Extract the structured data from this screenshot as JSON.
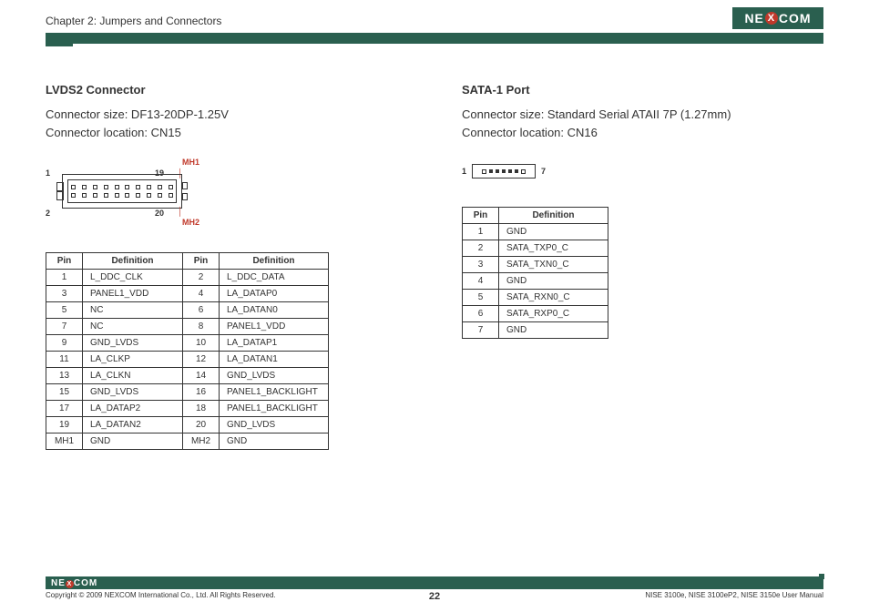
{
  "header": {
    "chapter": "Chapter 2: Jumpers and Connectors",
    "logo": "NE COM",
    "logoX": "X"
  },
  "left": {
    "title": "LVDS2 Connector",
    "size": "Connector size: DF13-20DP-1.25V",
    "location": "Connector location: CN15",
    "labels": {
      "p1": "1",
      "p2": "2",
      "p19": "19",
      "p20": "20",
      "mh1": "MH1",
      "mh2": "MH2"
    },
    "th": {
      "pin": "Pin",
      "def": "Definition"
    },
    "rows": [
      {
        "a": "1",
        "ad": "L_DDC_CLK",
        "b": "2",
        "bd": "L_DDC_DATA"
      },
      {
        "a": "3",
        "ad": "PANEL1_VDD",
        "b": "4",
        "bd": "LA_DATAP0"
      },
      {
        "a": "5",
        "ad": "NC",
        "b": "6",
        "bd": "LA_DATAN0"
      },
      {
        "a": "7",
        "ad": "NC",
        "b": "8",
        "bd": "PANEL1_VDD"
      },
      {
        "a": "9",
        "ad": "GND_LVDS",
        "b": "10",
        "bd": "LA_DATAP1"
      },
      {
        "a": "11",
        "ad": "LA_CLKP",
        "b": "12",
        "bd": "LA_DATAN1"
      },
      {
        "a": "13",
        "ad": "LA_CLKN",
        "b": "14",
        "bd": "GND_LVDS"
      },
      {
        "a": "15",
        "ad": "GND_LVDS",
        "b": "16",
        "bd": "PANEL1_BACKLIGHT"
      },
      {
        "a": "17",
        "ad": "LA_DATAP2",
        "b": "18",
        "bd": "PANEL1_BACKLIGHT"
      },
      {
        "a": "19",
        "ad": "LA_DATAN2",
        "b": "20",
        "bd": "GND_LVDS"
      },
      {
        "a": "MH1",
        "ad": "GND",
        "b": "MH2",
        "bd": "GND"
      }
    ]
  },
  "right": {
    "title": "SATA-1 Port",
    "size": "Connector size: Standard Serial ATAII 7P (1.27mm)",
    "location": "Connector location: CN16",
    "labels": {
      "p1": "1",
      "p7": "7"
    },
    "th": {
      "pin": "Pin",
      "def": "Definition"
    },
    "rows": [
      {
        "p": "1",
        "d": "GND"
      },
      {
        "p": "2",
        "d": "SATA_TXP0_C"
      },
      {
        "p": "3",
        "d": "SATA_TXN0_C"
      },
      {
        "p": "4",
        "d": "GND"
      },
      {
        "p": "5",
        "d": "SATA_RXN0_C"
      },
      {
        "p": "6",
        "d": "SATA_RXP0_C"
      },
      {
        "p": "7",
        "d": "GND"
      }
    ]
  },
  "footer": {
    "copyright": "Copyright © 2009 NEXCOM International Co., Ltd. All Rights Reserved.",
    "page": "22",
    "manual": "NISE 3100e, NISE 3100eP2, NISE 3150e User Manual",
    "logo": "NE COM",
    "logoX": "X"
  }
}
